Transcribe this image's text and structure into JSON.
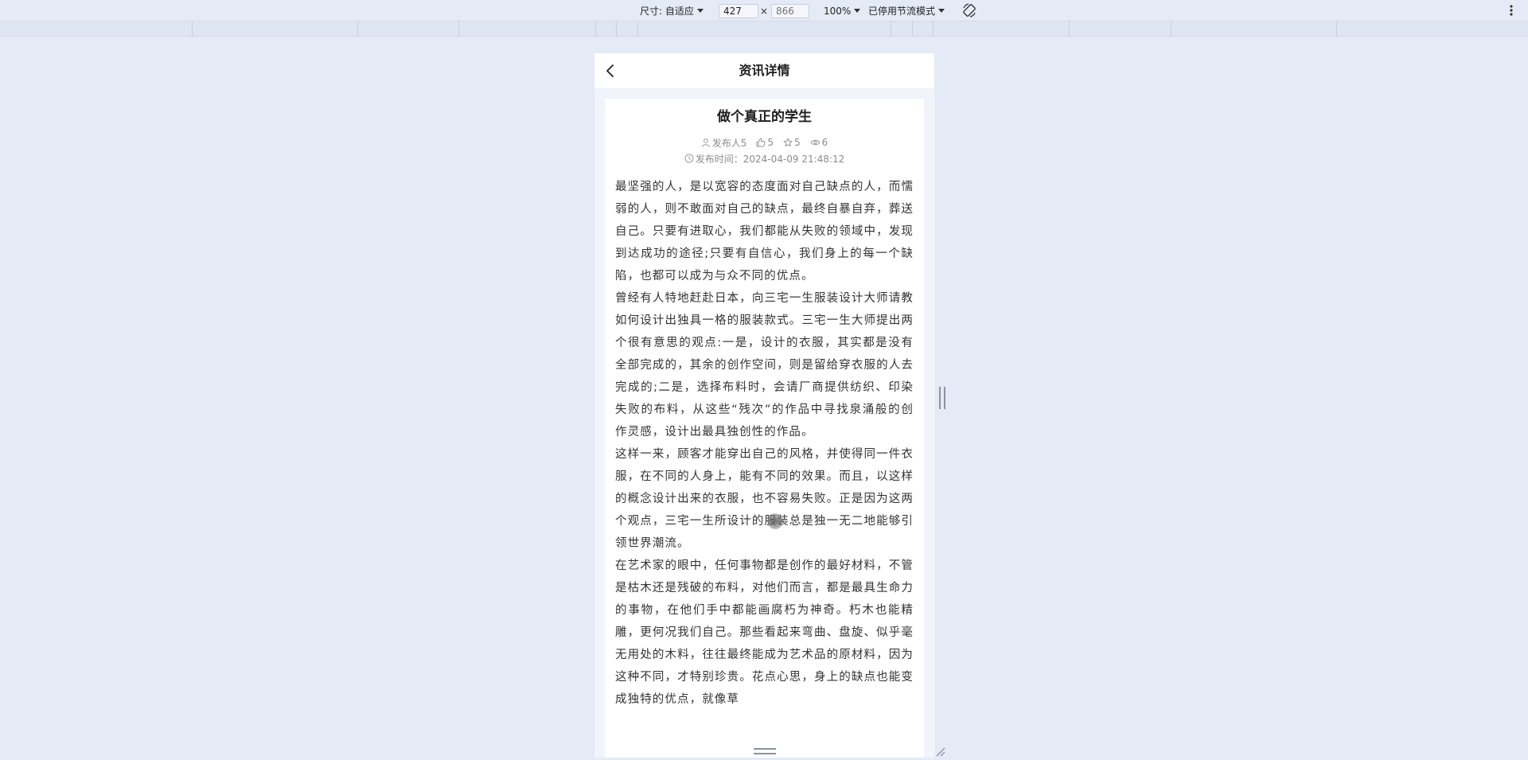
{
  "toolbar": {
    "dimensions_label": "尺寸: 自适应",
    "width_value": "427",
    "times_sign": "×",
    "height_placeholder": "866",
    "zoom_label": "100%",
    "throttle_label": "已停用节流模式"
  },
  "page": {
    "title": "资讯详情"
  },
  "article": {
    "title": "做个真正的学生",
    "publisher": "发布人5",
    "likes": "5",
    "favorites": "5",
    "views": "6",
    "publish_time": "发布时间：2024-04-09 21:48:12",
    "paragraphs": [
      "最坚强的人，是以宽容的态度面对自己缺点的人，而懦弱的人，则不敢面对自己的缺点，最终自暴自弃，葬送自己。只要有进取心，我们都能从失败的领域中，发现到达成功的途径;只要有自信心，我们身上的每一个缺陷，也都可以成为与众不同的优点。",
      "曾经有人特地赶赴日本，向三宅一生服装设计大师请教如何设计出独具一格的服装款式。三宅一生大师提出两个很有意思的观点:一是，设计的衣服，其实都是没有全部完成的，其余的创作空间，则是留给穿衣服的人去完成的;二是，选择布料时，会请厂商提供纺织、印染失败的布料，从这些“残次”的作品中寻找泉涌般的创作灵感，设计出最具独创性的作品。",
      "这样一来，顾客才能穿出自己的风格，并使得同一件衣服，在不同的人身上，能有不同的效果。而且，以这样的概念设计出来的衣服，也不容易失败。正是因为这两个观点，三宅一生所设计的服装总是独一无二地能够引领世界潮流。",
      "在艺术家的眼中，任何事物都是创作的最好材料，不管是枯木还是残破的布料，对他们而言，都是最具生命力的事物，在他们手中都能画腐朽为神奇。朽木也能精雕，更何况我们自己。那些看起来弯曲、盘旋、似乎毫无用处的木料，往往最终能成为艺术品的原材料，因为这种不同，才特别珍贵。花点心思，身上的缺点也能变成独特的优点，就像草"
    ]
  }
}
